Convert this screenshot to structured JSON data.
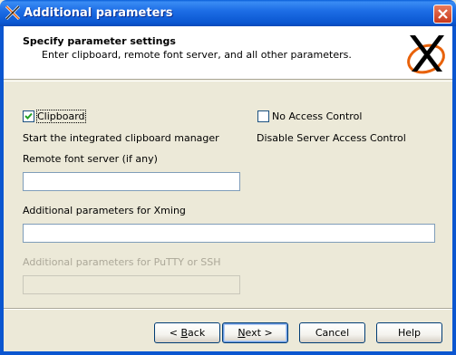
{
  "window": {
    "title": "Additional parameters",
    "icon": "xming-icon",
    "close_icon": "close-icon"
  },
  "header": {
    "title": "Specify parameter settings",
    "subtitle": "Enter clipboard, remote font server, and all other parameters.",
    "logo": "xming-logo"
  },
  "options": {
    "clipboard": {
      "label": "Clipboard",
      "checked": true,
      "description": "Start the integrated clipboard manager"
    },
    "no_access_control": {
      "label": "No Access Control",
      "checked": false,
      "description": "Disable Server Access Control"
    }
  },
  "fields": {
    "font_server": {
      "label": "Remote font server (if any)",
      "value": ""
    },
    "xming_params": {
      "label": "Additional parameters for Xming",
      "value": ""
    },
    "putty_params": {
      "label": "Additional parameters for PuTTY or SSH",
      "value": "",
      "disabled": true
    }
  },
  "buttons": {
    "back": {
      "label": "< Back",
      "mnemonic": "B"
    },
    "next": {
      "label": "Next >",
      "mnemonic": "N"
    },
    "cancel": {
      "label": "Cancel"
    },
    "help": {
      "label": "Help"
    }
  },
  "colors": {
    "titlebar": "#0a56d0",
    "dialog_bg": "#ece9d8",
    "disabled_text": "#aca899",
    "logo_orange": "#e8620b",
    "logo_black": "#000000"
  }
}
